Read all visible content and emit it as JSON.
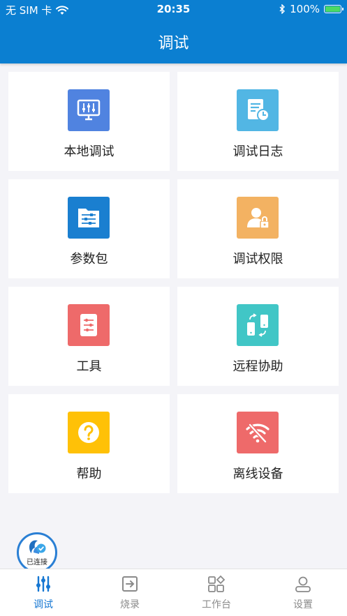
{
  "status_bar": {
    "carrier": "无 SIM 卡",
    "time": "20:35",
    "battery": "100%"
  },
  "header": {
    "title": "调试"
  },
  "tiles": [
    {
      "label": "本地调试",
      "icon": "monitor-sliders-icon",
      "color": "#5083e0"
    },
    {
      "label": "调试日志",
      "icon": "log-document-clock-icon",
      "color": "#52b6e4"
    },
    {
      "label": "参数包",
      "icon": "folder-sliders-icon",
      "color": "#1a7fd0"
    },
    {
      "label": "调试权限",
      "icon": "user-lock-icon",
      "color": "#f3b262"
    },
    {
      "label": "工具",
      "icon": "tool-list-icon",
      "color": "#ee6a6a"
    },
    {
      "label": "远程协助",
      "icon": "remote-phones-icon",
      "color": "#41c6c6"
    },
    {
      "label": "帮助",
      "icon": "help-question-icon",
      "color": "#ffc107"
    },
    {
      "label": "离线设备",
      "icon": "wifi-off-icon",
      "color": "#ee6a6a"
    }
  ],
  "connection": {
    "label": "已连接"
  },
  "tabbar": {
    "items": [
      {
        "label": "调试",
        "icon": "debug-sliders-icon",
        "active": true
      },
      {
        "label": "烧录",
        "icon": "burn-import-icon",
        "active": false
      },
      {
        "label": "工作台",
        "icon": "workbench-grid-icon",
        "active": false
      },
      {
        "label": "设置",
        "icon": "user-settings-icon",
        "active": false
      }
    ]
  },
  "colors": {
    "primary": "#0b7fd1",
    "active_tab": "#1677d2",
    "background": "#f4f4f8"
  }
}
